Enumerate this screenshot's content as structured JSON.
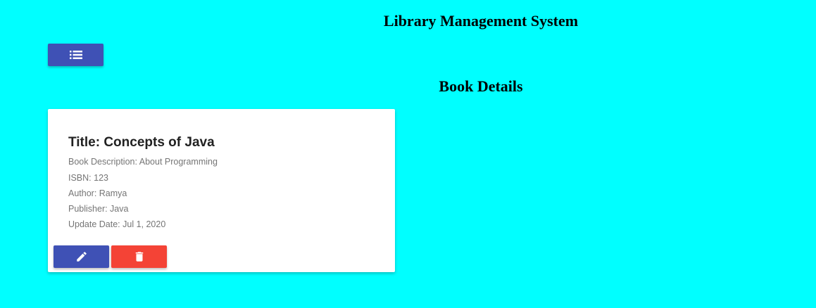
{
  "header": {
    "title": "Library Management System"
  },
  "toolbar": {
    "menu_icon": "list-icon",
    "menu_color": "#3f51b5"
  },
  "section": {
    "title": "Book Details"
  },
  "book_card": {
    "title": "Title: Concepts of Java",
    "description": "Book Description: About Programming",
    "isbn": "ISBN: 123",
    "author": "Author: Ramya",
    "publisher": "Publisher: Java",
    "update_date": "Update Date: Jul 1, 2020",
    "edit_icon": "pencil-icon",
    "edit_color": "#3f51b5",
    "delete_icon": "trash-icon",
    "delete_color": "#f44336"
  },
  "colors": {
    "background": "#00ffff",
    "card": "#ffffff"
  }
}
